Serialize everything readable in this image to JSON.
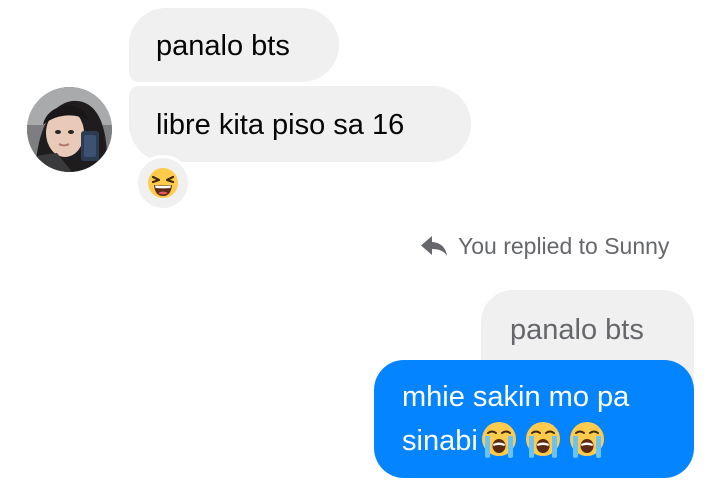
{
  "incoming": {
    "sender_name": "Sunny",
    "messages": [
      {
        "text": "panalo bts"
      },
      {
        "text": "libre kita piso sa 16"
      }
    ],
    "reaction_icon": "grinning-squinting-face-icon"
  },
  "reply_note": {
    "icon": "reply-arrow-icon",
    "text": "You replied to Sunny"
  },
  "quoted_message": {
    "text": "panalo bts"
  },
  "outgoing": {
    "line1": "mhie sakin mo pa",
    "line2": "sinabi",
    "emojis": [
      "loudly-crying-face-icon",
      "loudly-crying-face-icon",
      "loudly-crying-face-icon"
    ]
  },
  "colors": {
    "outgoing_bubble": "#0584ff",
    "incoming_bubble": "#f0f0f0",
    "meta_text": "#65676b"
  }
}
